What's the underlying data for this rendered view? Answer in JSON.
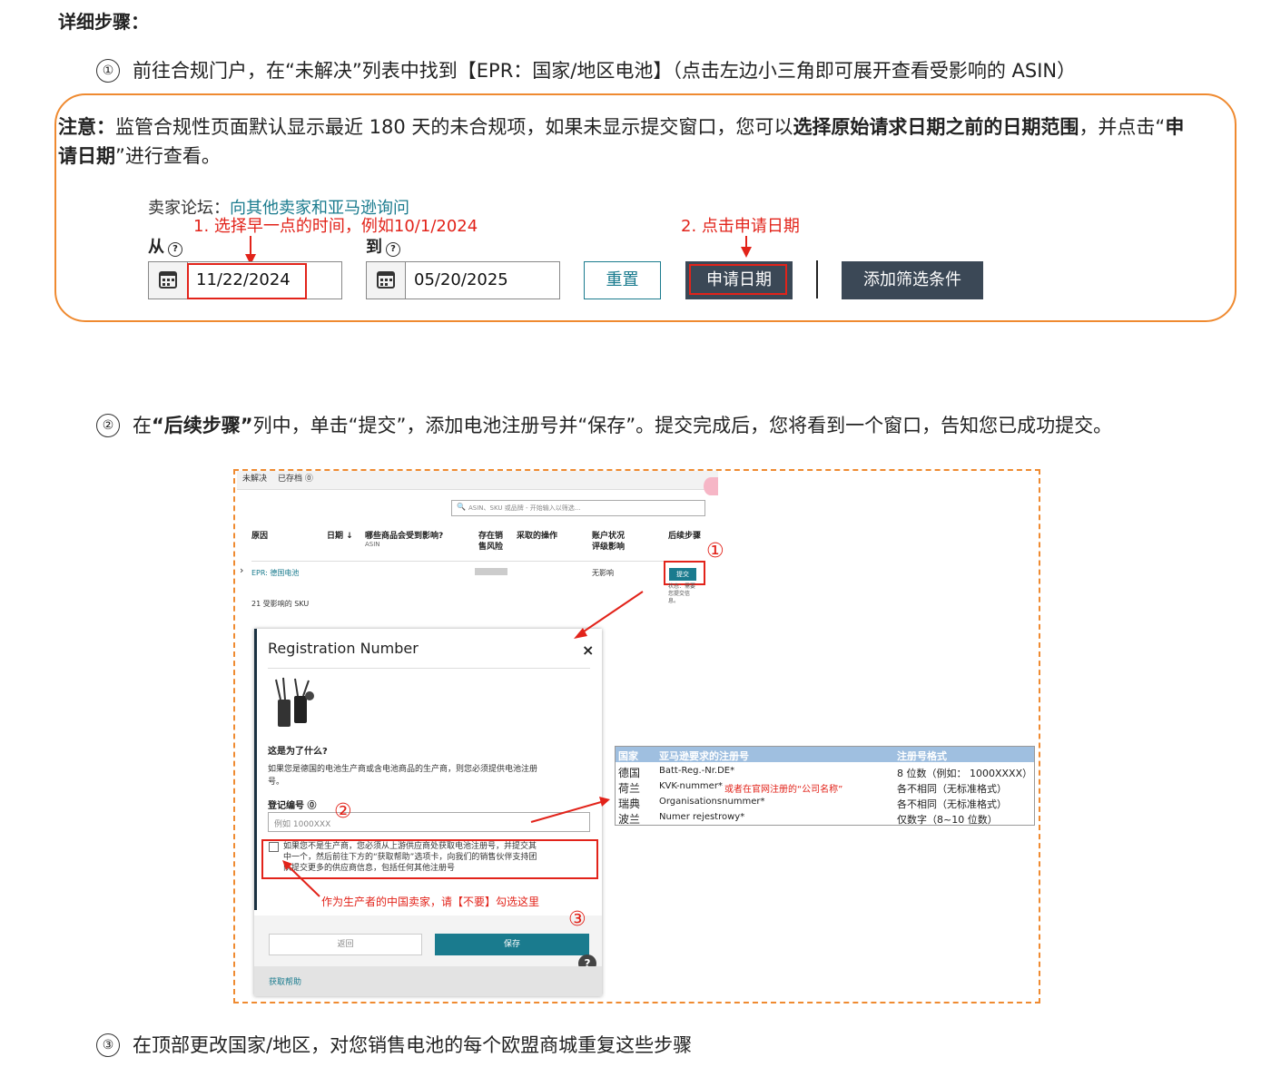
{
  "title": "详细步骤：",
  "step1": {
    "num": "①",
    "text": "前往合规门户，在“未解决”列表中找到【EPR：国家/地区电池】（点击左边小三角即可展开查看受影响的 ASIN）"
  },
  "note": {
    "label": "注意：",
    "text1": "监管合规性页面默认显示最近 180 天的未合规项，如果未显示提交窗口，您可以",
    "bold1": "选择原始请求日期之前的日期范围",
    "text2": "，并点击“",
    "bold2": "申请日期",
    "text3": "”进行查看。"
  },
  "filter": {
    "forum_prefix": "卖家论坛：",
    "forum_link": "向其他卖家和亚马逊询问",
    "ann1": "1. 选择早一点的时间，例如10/1/2024",
    "ann2": "2. 点击申请日期",
    "from_label": "从",
    "to_label": "到",
    "help": "?",
    "from_date": "11/22/2024",
    "to_date": "05/20/2025",
    "reset": "重置",
    "apply_date": "申请日期",
    "add_filter": "添加筛选条件"
  },
  "step2": {
    "num": "②",
    "pre": "在",
    "bold": "“后续步骤”",
    "post": "列中，单击“提交”，添加电池注册号并“保存”。提交完成后，您将看到一个窗口，告知您已成功提交。"
  },
  "portal": {
    "tab_unresolved": "未解决",
    "tab_archived": "已存档",
    "search_placeholder": "ASIN、SKU 或品牌 - 开始输入以筛选...",
    "col_reason": "原因",
    "col_date": "日期 ↓",
    "col_affected": "哪些商品会受到影响?",
    "col_affected_sub": "ASIN",
    "col_risk1": "存在销",
    "col_risk2": "售风险",
    "col_action": "采取的操作",
    "col_account1": "账户状况",
    "col_account2": "评级影响",
    "col_next": "后续步骤",
    "row_reason": "EPR: 德国电池",
    "row_impact": "无影响",
    "submit": "提交",
    "status1": "状态：需要",
    "status2": "您提交信",
    "status3": "息。",
    "sku_count": "21 受影响的 SKU"
  },
  "modal": {
    "title": "Registration Number",
    "close": "×",
    "why_title": "这是为了什么?",
    "why_text1": "如果您是德国的电池生产商或含电池商品的生产商，则您必须提供电池注册",
    "why_text2": "号。",
    "reg_label": "登记编号",
    "reg_placeholder": "例如 1000XXX",
    "checkbox_text1": "如果您不是生产商，您必须从上游供应商处获取电池注册号，并提交其",
    "checkbox_text2": "中一个，然后前往下方的“获取帮助”选项卡，向我们的销售伙伴支持团",
    "checkbox_text3": "队提交更多的供应商信息，包括任何其他注册号",
    "back": "返回",
    "save": "保存",
    "get_help": "获取帮助"
  },
  "annotations": {
    "c1": "①",
    "c2": "②",
    "c3": "③",
    "dont_check": "作为生产者的中国卖家，请【不要】勾选这里"
  },
  "reg_table": {
    "headers": [
      "国家",
      "亚马逊要求的注册号",
      "注册号格式"
    ],
    "rows": [
      {
        "country": "德国",
        "reg": "Batt-Reg.-Nr.DE*",
        "extra": "",
        "format": "8 位数（例如： 1000XXXX）"
      },
      {
        "country": "荷兰",
        "reg": "KVK-nummer*",
        "extra": "或者在官网注册的“公司名称”",
        "format": "各不相同（无标准格式）"
      },
      {
        "country": "瑞典",
        "reg": "Organisationsnummer*",
        "extra": "",
        "format": "各不相同（无标准格式）"
      },
      {
        "country": "波兰",
        "reg": "Numer rejestrowy*",
        "extra": "",
        "format": "仅数字（8~10 位数）"
      }
    ]
  },
  "step3": {
    "num": "③",
    "text": "在顶部更改国家/地区，对您销售电池的每个欧盟商城重复这些步骤"
  },
  "colors": {
    "accent_orange": "#ef8a30",
    "annotation_red": "#e2231a",
    "teal": "#1a7b8e",
    "dark_button": "#3b4856"
  }
}
